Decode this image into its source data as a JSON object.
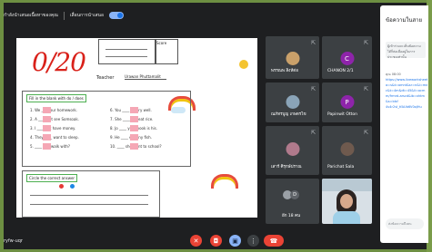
{
  "toolbar": {
    "left_label": "กำลังนำเสนอเนื้อหาของคุณ",
    "right_label": "เลื่อนการนำเสนอ",
    "toggle_on": true
  },
  "worksheet": {
    "score": "0/20",
    "teacher_label": "Teacher",
    "teacher_name": "Urawan Phuttamalit",
    "score_box_label": "Score",
    "exercise1_title": "Fill in the blank with do / does",
    "exercise2_title": "Circle the correct answer",
    "rows": [
      "1.  We ____ our homework.",
      "2.  A ____ not see Somsoak.",
      "3.  I ____ not have money.",
      "4.  They ____ want to sleep.",
      "5.  ____ you walk with?",
      "6.  You ____ it very well.",
      "7.  She ____ not eat rice.",
      "8.  Jo ____ your book is his.",
      "9.  He ____ eat any fish.",
      "10. ____ she want to school?"
    ]
  },
  "participants": [
    {
      "name": "พรรณพ สิงห์ต่อ",
      "kind": "photo"
    },
    {
      "name": "CHANON 2/1",
      "kind": "letter",
      "letter": "C",
      "color": "#8e24aa"
    },
    {
      "name": "ณภัทรบูญ เกษตรไข",
      "kind": "photo"
    },
    {
      "name": "Papinwit Otton",
      "kind": "letter",
      "letter": "P",
      "color": "#8e24aa"
    },
    {
      "name": "เสาร์ ศิรุกษ์ปราณ",
      "kind": "photo"
    },
    {
      "name": "Parichat Sala",
      "kind": "photo"
    },
    {
      "name": "อีก 18 คน",
      "kind": "more"
    }
  ],
  "chat": {
    "title": "ข้อความในสาย",
    "note": "ผู้เข้าร่วมจะเห็นข้อความได้ก็ต่อเมื่ออยู่ในการประชุมเท่านั้น",
    "meta": "คุณ  08:00",
    "links": [
      "https://www.liveworksheets.com/",
      "a=s&t=amnt&sr=n&l=md&i=",
      "c&t=4m&dt=45&li=ocm",
      "m/frmrd-arscd&ib=xhtm",
      "&s=blsf",
      "4v4r2vI_tfAUb6V0oJHu"
    ],
    "input_placeholder": "ส่งข้อความถึงคน"
  },
  "bottom": {
    "meeting_code": "ryfw-uqr"
  },
  "controls": [
    {
      "name": "mic-off-button",
      "icon": "mic-off-icon",
      "glyph": "✕",
      "color": "#ea4335"
    },
    {
      "name": "camera-button",
      "icon": "camera-icon",
      "glyph": "◘",
      "color": "#ea4335"
    },
    {
      "name": "present-button",
      "icon": "present-icon",
      "glyph": "▣",
      "color": "#8ab4f8"
    },
    {
      "name": "more-options-button",
      "icon": "more-vert-icon",
      "glyph": "⋮",
      "color": "#3c4043"
    },
    {
      "name": "end-call-button",
      "icon": "call-end-icon",
      "glyph": "☎",
      "color": "#ea4335"
    }
  ]
}
